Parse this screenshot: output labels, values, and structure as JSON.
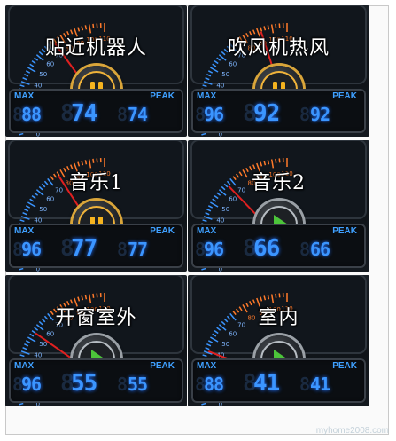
{
  "tiles": [
    {
      "label": "贴近机器人",
      "control": "pause",
      "max": "88",
      "current": "74",
      "peak": "74"
    },
    {
      "label": "吹风机热风",
      "control": "pause",
      "max": "96",
      "current": "92",
      "peak": "92"
    },
    {
      "label": "音乐1",
      "control": "pause",
      "max": "96",
      "current": "77",
      "peak": "77"
    },
    {
      "label": "音乐2",
      "control": "play",
      "max": "96",
      "current": "66",
      "peak": "66"
    },
    {
      "label": "开窗室外",
      "control": "play",
      "max": "96",
      "current": "55",
      "peak": "55"
    },
    {
      "label": "室内",
      "control": "play",
      "max": "88",
      "current": "41",
      "peak": "41"
    }
  ],
  "panel_labels": {
    "max": "MAX",
    "peak": "PEAK"
  },
  "scale_ticks": [
    "0",
    "10",
    "20",
    "30",
    "40",
    "50",
    "60",
    "70",
    "80",
    "90",
    "100",
    "110"
  ],
  "colors": {
    "accent_blue": "#3b95ff",
    "accent_orange": "#ff7a2a",
    "pause_ring": "#d9a53a",
    "play_green": "#4cc43a",
    "needle_red": "#e02020"
  },
  "watermark": "myhome2008.com"
}
